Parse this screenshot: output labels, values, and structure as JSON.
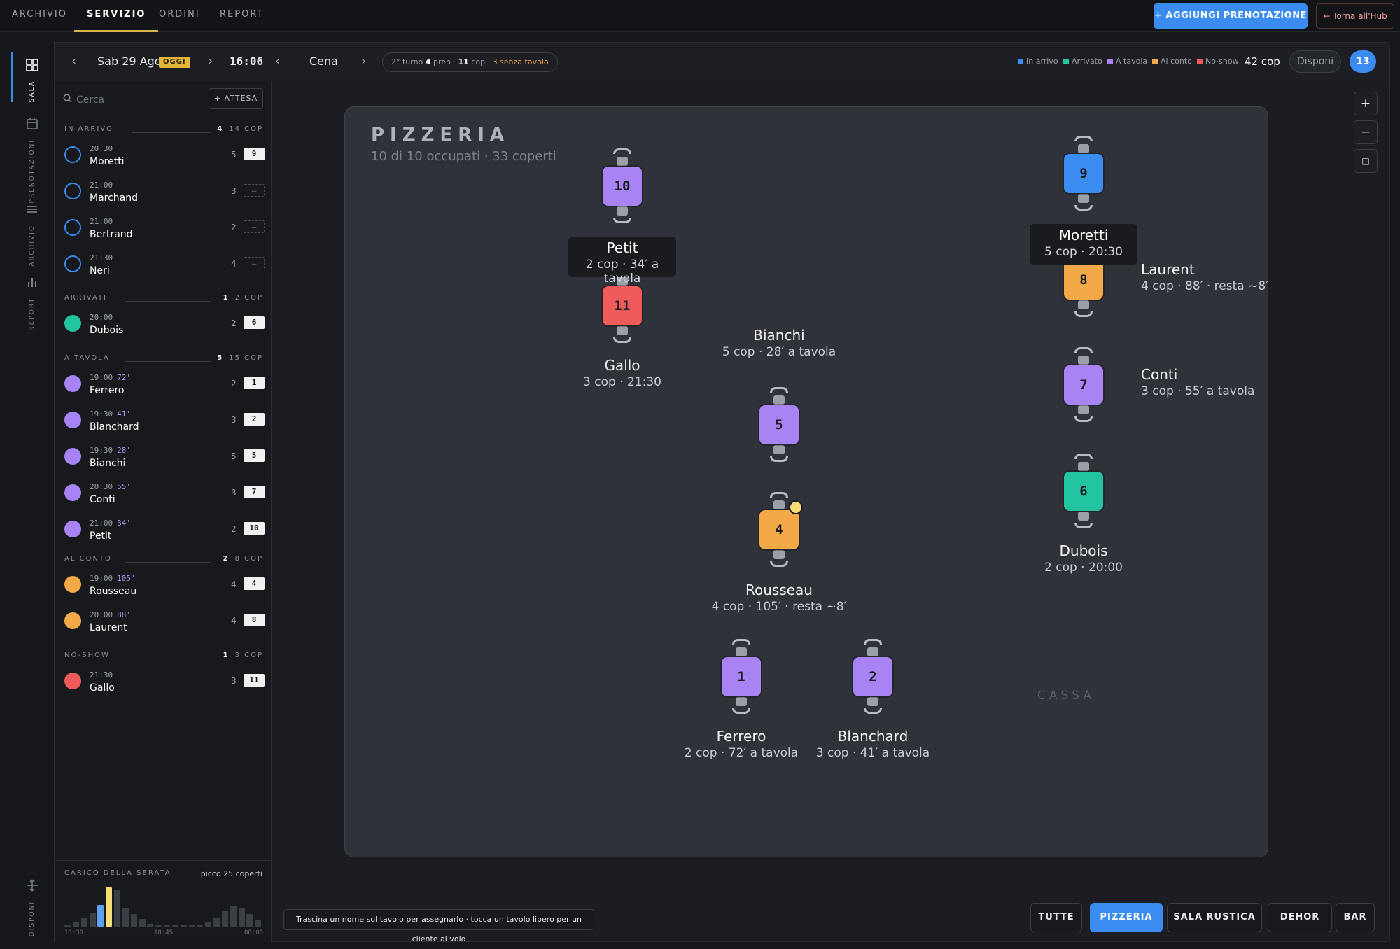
{
  "topnav": {
    "tabs": [
      {
        "label": "ARCHIVIO",
        "active": false
      },
      {
        "label": "SERVIZIO",
        "active": true
      },
      {
        "label": "ORDINI",
        "active": false
      },
      {
        "label": "REPORT",
        "active": false
      }
    ],
    "add_button": "+ AGGIUNGI PRENOTAZIONE",
    "hub_button": "← Torna all'Hub"
  },
  "rail": [
    {
      "label": "SALA",
      "icon": "grid-icon",
      "active": true
    },
    {
      "label": "PRENOTAZIONI",
      "icon": "calendar-icon",
      "active": false
    },
    {
      "label": "ARCHIVIO",
      "icon": "list-icon",
      "active": false
    },
    {
      "label": "REPORT",
      "icon": "bar-chart-icon",
      "active": false
    },
    {
      "label": "DISPONI",
      "icon": "arrows-icon",
      "active": false
    }
  ],
  "toolbar": {
    "date": "Sab 29 Ago",
    "today_badge": "OGGI",
    "time": "16:06",
    "service": "Cena",
    "turn": {
      "label": "2° turno",
      "pren_count": "4",
      "pren_label": "pren",
      "cop_count": "11",
      "cop_label": "cop",
      "warning": "3 senza tavolo"
    },
    "legend": [
      {
        "label": "In arrivo",
        "color": "#3b8cf0"
      },
      {
        "label": "Arrivato",
        "color": "#22c4a2"
      },
      {
        "label": "A tavola",
        "color": "#a883f3"
      },
      {
        "label": "Al conto",
        "color": "#f3a948"
      },
      {
        "label": "No-show",
        "color": "#ef5b5b"
      }
    ],
    "total_covers": "42 cop",
    "disponi_label": "Disponi",
    "badge": "13"
  },
  "sidebar": {
    "search_placeholder": "Cerca",
    "attesa_button": "+ ATTESA",
    "sections": [
      {
        "title": "IN ARRIVO",
        "count": "4",
        "cop": "14 COP",
        "dot": "ring",
        "color": "#3b8cf0",
        "items": [
          {
            "time": "20:30",
            "elapsed": "",
            "name": "Moretti",
            "covers": "5",
            "table": "9"
          },
          {
            "time": "21:00",
            "elapsed": "",
            "name": "Marchand",
            "covers": "3",
            "table": "–"
          },
          {
            "time": "21:00",
            "elapsed": "",
            "name": "Bertrand",
            "covers": "2",
            "table": "–"
          },
          {
            "time": "21:30",
            "elapsed": "",
            "name": "Neri",
            "covers": "4",
            "table": "–"
          }
        ]
      },
      {
        "title": "ARRIVATI",
        "count": "1",
        "cop": "2 COP",
        "dot": "fill",
        "color": "#22c4a2",
        "items": [
          {
            "time": "20:00",
            "elapsed": "",
            "name": "Dubois",
            "covers": "2",
            "table": "6"
          }
        ]
      },
      {
        "title": "A TAVOLA",
        "count": "5",
        "cop": "15 COP",
        "dot": "fill",
        "color": "#a883f3",
        "items": [
          {
            "time": "19:00",
            "elapsed": "72'",
            "name": "Ferrero",
            "covers": "2",
            "table": "1"
          },
          {
            "time": "19:30",
            "elapsed": "41'",
            "name": "Blanchard",
            "covers": "3",
            "table": "2"
          },
          {
            "time": "19:30",
            "elapsed": "28'",
            "name": "Bianchi",
            "covers": "5",
            "table": "5"
          },
          {
            "time": "20:30",
            "elapsed": "55'",
            "name": "Conti",
            "covers": "3",
            "table": "7"
          },
          {
            "time": "21:00",
            "elapsed": "34'",
            "name": "Petit",
            "covers": "2",
            "table": "10"
          }
        ]
      },
      {
        "title": "AL CONTO",
        "count": "2",
        "cop": "8 COP",
        "dot": "fill",
        "color": "#f3a948",
        "items": [
          {
            "time": "19:00",
            "elapsed": "105'",
            "name": "Rousseau",
            "covers": "4",
            "table": "4"
          },
          {
            "time": "20:00",
            "elapsed": "88'",
            "name": "Laurent",
            "covers": "4",
            "table": "8"
          }
        ]
      },
      {
        "title": "NO-SHOW",
        "count": "1",
        "cop": "3 COP",
        "dot": "fill",
        "color": "#ef5b5b",
        "items": [
          {
            "time": "21:30",
            "elapsed": "",
            "name": "Gallo",
            "covers": "3",
            "table": "11"
          }
        ]
      }
    ],
    "load": {
      "title": "CARICO DELLA SERATA",
      "peak": "picco 25 coperti",
      "ticks": [
        "13:30",
        "18:45",
        "00:00"
      ],
      "values": [
        1,
        3,
        6,
        9,
        14,
        25,
        23,
        12,
        8,
        5,
        2,
        1,
        1,
        1,
        1,
        1,
        1,
        3,
        6,
        10,
        13,
        12,
        8,
        4
      ],
      "highlight": [
        4,
        5
      ]
    }
  },
  "room": {
    "title": "PIZZERIA",
    "subtitle": "10 di 10 occupati · 33 coperti",
    "cassa": "CASSA",
    "tables": [
      {
        "num": "1",
        "status": "#a883f3",
        "indicator": false
      },
      {
        "num": "2",
        "status": "#a883f3",
        "indicator": false
      },
      {
        "num": "4",
        "status": "#f3a948",
        "indicator": true
      },
      {
        "num": "5",
        "status": "#a883f3",
        "indicator": false
      },
      {
        "num": "6",
        "status": "#22c4a2",
        "indicator": false
      },
      {
        "num": "7",
        "status": "#a883f3",
        "indicator": false
      },
      {
        "num": "8",
        "status": "#f3a948",
        "indicator": true
      },
      {
        "num": "9",
        "status": "#3b8cf0",
        "indicator": false
      },
      {
        "num": "10",
        "status": "#a883f3",
        "indicator": false
      },
      {
        "num": "11",
        "status": "#ef5b5b",
        "indicator": false
      }
    ],
    "labels": [
      {
        "name": "Ferrero",
        "info": "2 cop · 72′ a tavola"
      },
      {
        "name": "Blanchard",
        "info": "3 cop · 41′ a tavola"
      },
      {
        "name": "Rousseau",
        "info": "4 cop · 105′ · resta ~8′"
      },
      {
        "name": "Bianchi",
        "info": "5 cop · 28′ a tavola"
      },
      {
        "name": "Dubois",
        "info": "2 cop · 20:00"
      },
      {
        "name": "Conti",
        "info": "3 cop · 55′ a tavola"
      },
      {
        "name": "Laurent",
        "info": "4 cop · 88′ · resta ~8′"
      },
      {
        "name": "Moretti",
        "info": "5 cop · 20:30"
      },
      {
        "name": "Petit",
        "info": "2 cop · 34′ a tavola"
      },
      {
        "name": "Gallo",
        "info": "3 cop · 21:30"
      }
    ]
  },
  "zoom": [
    "+",
    "−",
    "□"
  ],
  "hint": "Trascina un nome sul tavolo per assegnarlo · tocca un tavolo libero per un cliente al volo",
  "room_tabs": [
    {
      "label": "TUTTE",
      "active": false
    },
    {
      "label": "PIZZERIA",
      "active": true
    },
    {
      "label": "SALA RUSTICA",
      "active": false
    },
    {
      "label": "DEHOR",
      "active": false
    },
    {
      "label": "BAR",
      "active": false
    }
  ]
}
